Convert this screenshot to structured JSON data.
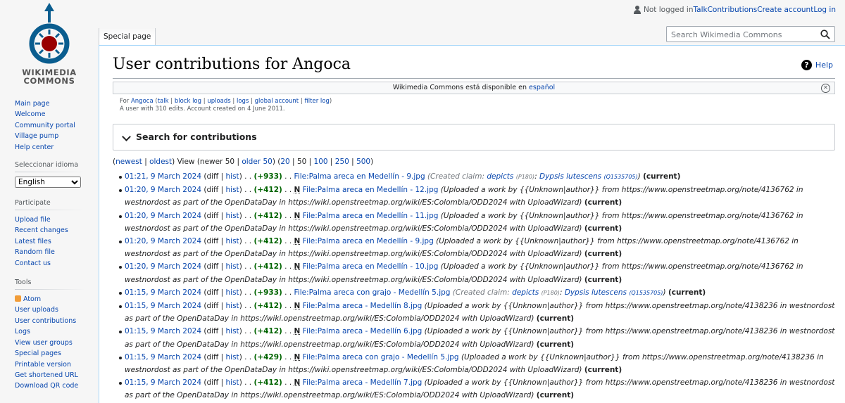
{
  "logo": {
    "line1": "WIKIMEDIA",
    "line2": "COMMONS"
  },
  "personal": {
    "not_logged": "Not logged in",
    "talk": "Talk",
    "contributions": "Contributions",
    "create": "Create account",
    "login": "Log in"
  },
  "tabs": {
    "special": "Special page"
  },
  "search": {
    "placeholder": "Search Wikimedia Commons"
  },
  "title": "User contributions for Angoca",
  "help": "Help",
  "notice": {
    "text": "Wikimedia Commons está disponible en ",
    "link": "español"
  },
  "userinfo": {
    "for": "For ",
    "user": "Angoca",
    "open": " (",
    "talk": "talk",
    "p1": " | ",
    "block": "block log",
    "p2": " | ",
    "uploads": "uploads",
    "p3": " | ",
    "logs": "logs",
    "p4": " | ",
    "global": "global account",
    "p5": " | ",
    "filter": "filter log",
    "close": ")",
    "line2": "A user with 310 edits. Account created on 4 June 2011."
  },
  "search_contrib": "Search for contributions",
  "pager": {
    "p0": "(",
    "newest": "newest",
    "s1": " | ",
    "oldest": "oldest",
    "p1": ") View (newer 50 | ",
    "older": "older 50",
    "p2": ") (",
    "n20": "20",
    "s2": " | ",
    "n50": "50",
    "s3": " | ",
    "n100": "100",
    "s4": " | ",
    "n250": "250",
    "s5": " | ",
    "n500": "500",
    "p3": ")"
  },
  "common": {
    "diff": "diff",
    "hist": "hist",
    "dots": " . . ",
    "N": "N",
    "current": "(current)",
    "created_claim": "(Created claim: ",
    "depicts": "depicts",
    "p180": "(P180)",
    "colon": ": ",
    "dypsis": "Dypsis lutescens",
    "q": "(Q1535705)",
    "endparen": ")"
  },
  "contribs": [
    {
      "time": "01:21, 9 March 2024",
      "diff": "(+933)",
      "file": "File:Palma areca en Medellín - 9.jpg"
    },
    {
      "time": "01:20, 9 March 2024",
      "diff": "(+412)",
      "file": "File:Palma areca en Medellín - 12.jpg",
      "comment": "(Uploaded a work by {{Unknown|author}} from https://www.openstreetmap.org/note/4136762 in westnordost as part of the OpenDataDay in https://wiki.openstreetmap.org/wiki/ES:Colombia/ODD2024 with UploadWizard)"
    },
    {
      "time": "01:20, 9 March 2024",
      "diff": "(+412)",
      "file": "File:Palma areca en Medellín - 11.jpg",
      "comment": "(Uploaded a work by {{Unknown|author}} from https://www.openstreetmap.org/note/4136762 in westnordost as part of the OpenDataDay in https://wiki.openstreetmap.org/wiki/ES:Colombia/ODD2024 with UploadWizard)"
    },
    {
      "time": "01:20, 9 March 2024",
      "diff": "(+412)",
      "file": "File:Palma areca en Medellín - 9.jpg",
      "comment": "(Uploaded a work by {{Unknown|author}} from https://www.openstreetmap.org/note/4136762 in westnordost as part of the OpenDataDay in https://wiki.openstreetmap.org/wiki/ES:Colombia/ODD2024 with UploadWizard)"
    },
    {
      "time": "01:20, 9 March 2024",
      "diff": "(+412)",
      "file": "File:Palma areca en Medellín - 10.jpg",
      "comment": "(Uploaded a work by {{Unknown|author}} from https://www.openstreetmap.org/note/4136762 in westnordost as part of the OpenDataDay in https://wiki.openstreetmap.org/wiki/ES:Colombia/ODD2024 with UploadWizard)"
    },
    {
      "time": "01:15, 9 March 2024",
      "diff": "(+933)",
      "file": "File:Palma areca con grajo - Medellín 5.jpg"
    },
    {
      "time": "01:15, 9 March 2024",
      "diff": "(+412)",
      "file": "File:Palma areca - Medellín 8.jpg",
      "comment": "(Uploaded a work by {{Unknown|author}} from https://www.openstreetmap.org/note/4138236 in westnordost as part of the OpenDataDay in https://wiki.openstreetmap.org/wiki/ES:Colombia/ODD2024 with UploadWizard)"
    },
    {
      "time": "01:15, 9 March 2024",
      "diff": "(+412)",
      "file": "File:Palma areca - Medellín 6.jpg",
      "comment": "(Uploaded a work by {{Unknown|author}} from https://www.openstreetmap.org/note/4138236 in westnordost as part of the OpenDataDay in https://wiki.openstreetmap.org/wiki/ES:Colombia/ODD2024 with UploadWizard)"
    },
    {
      "time": "01:15, 9 March 2024",
      "diff": "(+429)",
      "file": "File:Palma areca con grajo - Medellín 5.jpg",
      "comment": "(Uploaded a work by {{Unknown|author}} from https://www.openstreetmap.org/note/4138236 in westnordost as part of the OpenDataDay in https://wiki.openstreetmap.org/wiki/ES:Colombia/ODD2024 with UploadWizard)"
    },
    {
      "time": "01:15, 9 March 2024",
      "diff": "(+412)",
      "file": "File:Palma areca - Medellín 7.jpg",
      "comment": "(Uploaded a work by {{Unknown|author}} from https://www.openstreetmap.org/note/4138236 in westnordost as part of the OpenDataDay in https://wiki.openstreetmap.org/wiki/ES:Colombia/ODD2024 with UploadWizard)"
    }
  ],
  "sidebar": {
    "nav": [
      "Main page",
      "Welcome",
      "Community portal",
      "Village pump",
      "Help center"
    ],
    "lang_heading": "Seleccionar idioma",
    "lang_value": "English",
    "participate_heading": "Participate",
    "participate": [
      "Upload file",
      "Recent changes",
      "Latest files",
      "Random file",
      "Contact us"
    ],
    "tools_heading": "Tools",
    "atom": "Atom",
    "tools": [
      "User uploads",
      "User contributions",
      "Logs",
      "View user groups",
      "Special pages",
      "Printable version",
      "Get shortened URL",
      "Download QR code"
    ]
  },
  "colors": {
    "link": "#0645ad",
    "positive": "#006400",
    "logo_blue": "#0a5d8f",
    "logo_red": "#990000",
    "border": "#a7d7f9"
  }
}
